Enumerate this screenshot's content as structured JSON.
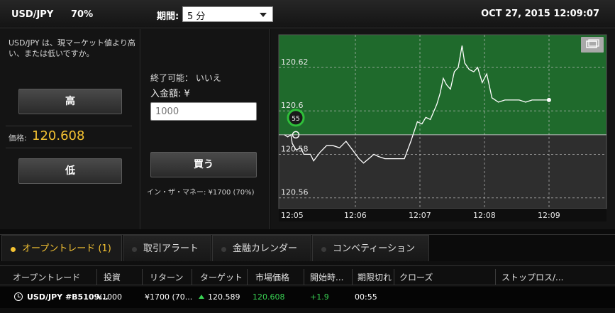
{
  "header": {
    "pair": "USD/JPY",
    "payout": "70%",
    "period_label": "期間:",
    "period_value": "5 分",
    "datetime": "OCT 27, 2015 12:09:07"
  },
  "left_panel": {
    "question": "USD/JPY は、現マーケット値より高い、または低いですか。",
    "high_label": "高",
    "price_label": "価格:",
    "price_value": "120.608",
    "low_label": "低"
  },
  "mid_panel": {
    "expiry_text": "終了可能： いいえ",
    "amount_label": "入金額: ¥",
    "amount_value": "1000",
    "buy_label": "買う",
    "in_the_money": "イン・ザ・マネー: ¥1700 (70%)"
  },
  "chart": {
    "y_labels": [
      "120.62",
      "120.6",
      "120.58",
      "120.56"
    ],
    "x_labels": [
      "12:05",
      "12:06",
      "12:07",
      "12:08",
      "12:09"
    ],
    "marker_label": "55"
  },
  "chart_data": {
    "type": "line",
    "ylim": [
      120.555,
      120.635
    ],
    "x_ticks": [
      "12:05",
      "12:06",
      "12:07",
      "12:08",
      "12:09"
    ],
    "y_ticks": [
      120.62,
      120.6,
      120.58,
      120.56
    ],
    "strike": 120.589,
    "series": [
      {
        "points": [
          [
            0.0,
            120.589
          ],
          [
            0.05,
            120.588
          ],
          [
            0.1,
            120.589
          ],
          [
            0.12,
            120.585
          ],
          [
            0.18,
            120.582
          ],
          [
            0.25,
            120.583
          ],
          [
            0.3,
            120.58
          ],
          [
            0.4,
            120.58
          ],
          [
            0.45,
            120.577
          ],
          [
            0.55,
            120.581
          ],
          [
            0.65,
            120.584
          ],
          [
            0.75,
            120.584
          ],
          [
            0.85,
            120.583
          ],
          [
            0.95,
            120.586
          ],
          [
            1.05,
            120.582
          ],
          [
            1.15,
            120.578
          ],
          [
            1.22,
            120.576
          ],
          [
            1.3,
            120.578
          ],
          [
            1.38,
            120.58
          ],
          [
            1.45,
            120.579
          ],
          [
            1.55,
            120.578
          ],
          [
            1.65,
            120.578
          ],
          [
            1.75,
            120.578
          ],
          [
            1.85,
            120.578
          ],
          [
            1.95,
            120.586
          ],
          [
            2.05,
            120.595
          ],
          [
            2.12,
            120.594
          ],
          [
            2.18,
            120.597
          ],
          [
            2.25,
            120.596
          ],
          [
            2.35,
            120.603
          ],
          [
            2.4,
            120.608
          ],
          [
            2.45,
            120.615
          ],
          [
            2.5,
            120.612
          ],
          [
            2.56,
            120.61
          ],
          [
            2.62,
            120.618
          ],
          [
            2.68,
            120.62
          ],
          [
            2.74,
            120.63
          ],
          [
            2.78,
            120.622
          ],
          [
            2.85,
            120.619
          ],
          [
            2.92,
            120.618
          ],
          [
            2.98,
            120.62
          ],
          [
            3.05,
            120.613
          ],
          [
            3.12,
            120.617
          ],
          [
            3.2,
            120.606
          ],
          [
            3.3,
            120.604
          ],
          [
            3.4,
            120.605
          ],
          [
            3.5,
            120.605
          ],
          [
            3.62,
            120.605
          ],
          [
            3.72,
            120.604
          ],
          [
            3.82,
            120.605
          ],
          [
            3.92,
            120.605
          ],
          [
            4.08,
            120.605
          ]
        ]
      }
    ]
  },
  "tabs": [
    {
      "label": "オープントレード (1)",
      "active": true
    },
    {
      "label": "取引アラート",
      "active": false
    },
    {
      "label": "金融カレンダー",
      "active": false
    },
    {
      "label": "コンベティーション",
      "active": false
    }
  ],
  "table": {
    "headers": [
      "オープントレード",
      "投資",
      "リターン",
      "ターゲット",
      "市場価格",
      "開始時...",
      "期限切れ",
      "クローズ",
      "ストップロス/..."
    ],
    "row": {
      "asset": "USD/JPY #B5109...",
      "investment": "¥1000",
      "return": "¥1700 (70...",
      "target": "120.589",
      "market_price": "120.608",
      "change": "+1.9",
      "expiry": "00:55"
    }
  },
  "colors": {
    "accent": "#f4c232",
    "green_zone": "#1f6a2c",
    "up": "#39d353"
  }
}
